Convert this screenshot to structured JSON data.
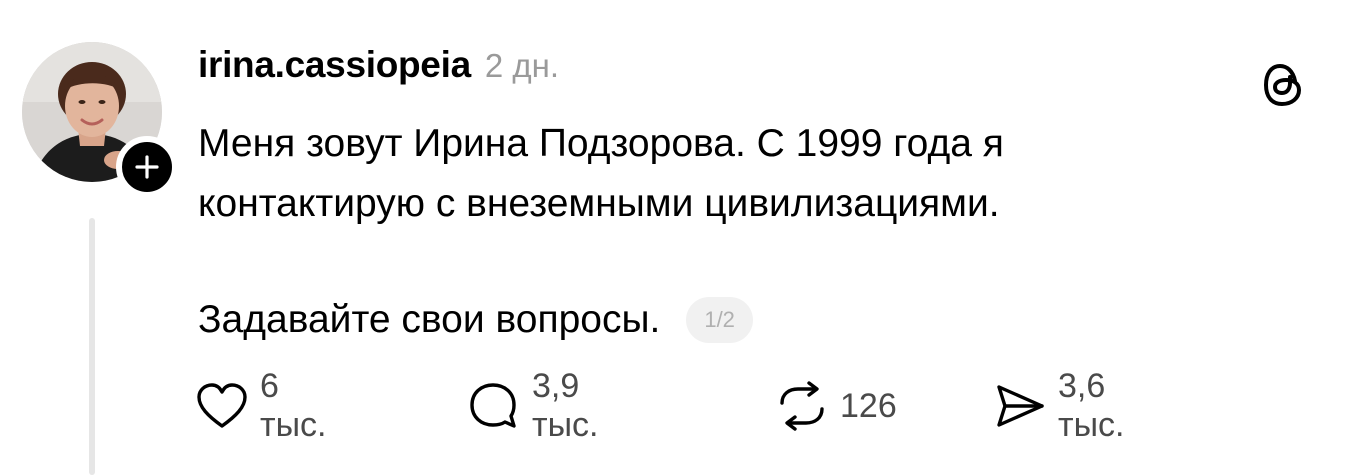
{
  "post": {
    "username": "irina.cassiopeia",
    "timestamp": "2 дн.",
    "text_line1": "Меня зовут Ирина Подзорова. С 1999 года я",
    "text_line2": "контактирую с внеземными цивилизациями.",
    "text_para2": "Задавайте свои вопросы.",
    "page_indicator": "1/2"
  },
  "actions": {
    "like_count": "6 тыс.",
    "reply_count": "3,9 тыс.",
    "repost_count": "126",
    "share_count": "3,6 тыс."
  },
  "icons": {
    "avatar": "profile-photo",
    "follow": "plus-icon",
    "logo": "threads-logo-icon",
    "like": "heart-icon",
    "reply": "comment-bubble-icon",
    "repost": "repost-arrows-icon",
    "share": "send-icon"
  },
  "colors": {
    "text": "#000000",
    "muted": "#9a9a9a",
    "action_count": "#4a4a4a",
    "badge_bg": "#f1f1f1",
    "thread_line": "#e6e6e6"
  }
}
